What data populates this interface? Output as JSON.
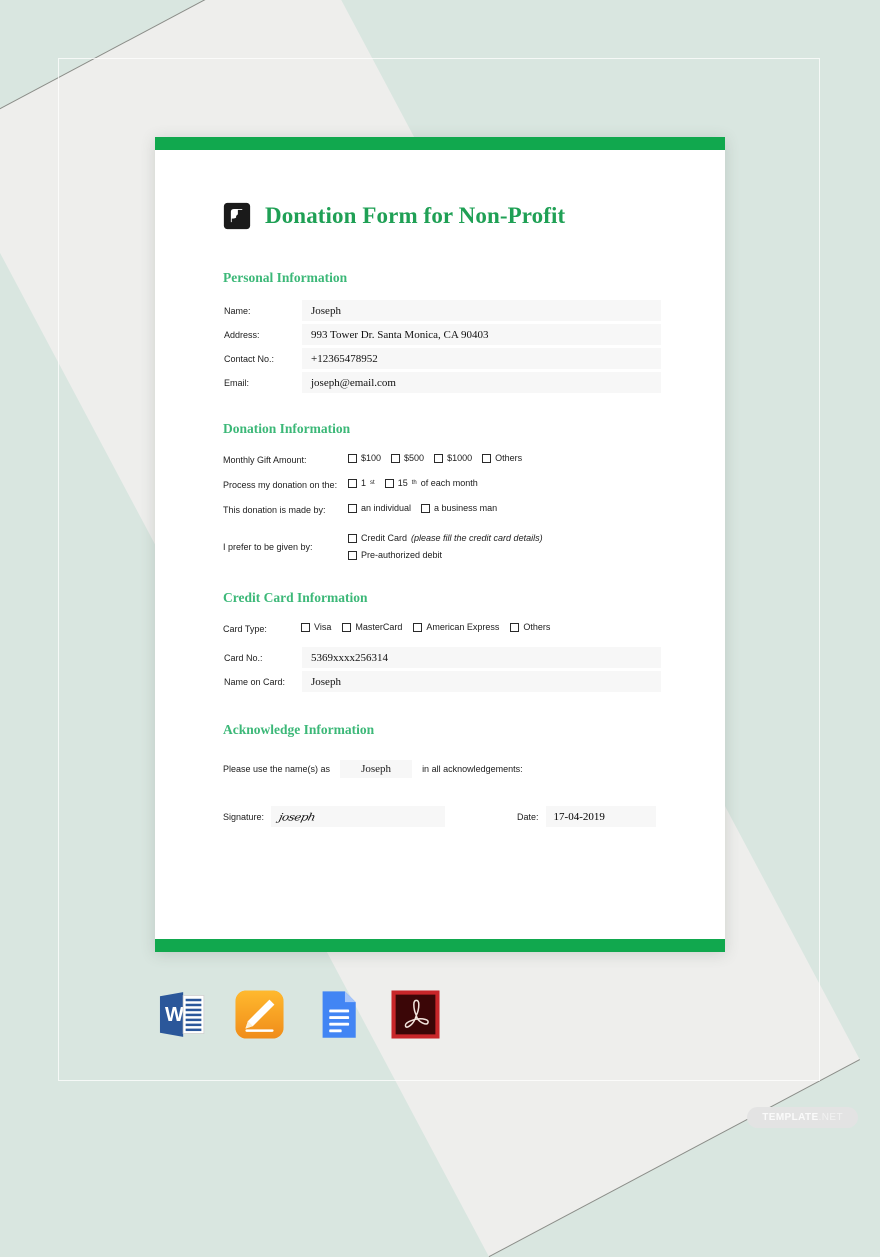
{
  "document": {
    "title": "Donation Form for Non-Profit",
    "logo_icon": "leaf-square-logo-icon",
    "accent_color": "#11a84e",
    "heading_color": "#3cb878",
    "background_color": "#d9e6e0"
  },
  "personal_information": {
    "heading": "Personal Information",
    "fields": [
      {
        "label": "Name:",
        "value": "Joseph"
      },
      {
        "label": "Address:",
        "value": "993 Tower Dr. Santa Monica, CA 90403"
      },
      {
        "label": "Contact No.:",
        "value": "+12365478952"
      },
      {
        "label": "Email:",
        "value": "joseph@email.com"
      }
    ]
  },
  "donation_information": {
    "heading": "Donation Information",
    "gift_amount": {
      "label": "Monthly Gift Amount:",
      "options": [
        "$100",
        "$500",
        "$1000",
        "Others"
      ]
    },
    "process_date": {
      "label": "Process my donation on the:",
      "options": [
        "1",
        "15"
      ],
      "superscripts": [
        "st",
        "th"
      ],
      "tail": "of each month"
    },
    "donor_type": {
      "label": "This donation is made by:",
      "options": [
        "an individual",
        "a business man"
      ]
    },
    "payment_method": {
      "label": "I prefer to be given by:",
      "options": [
        "Credit Card",
        "Pre-authorized debit"
      ],
      "note": "(please fill the credit card details)"
    }
  },
  "credit_card_information": {
    "heading": "Credit Card Information",
    "card_type": {
      "label": "Card Type:",
      "options": [
        "Visa",
        "MasterCard",
        "American Express",
        "Others"
      ]
    },
    "fields": [
      {
        "label": "Card No.:",
        "value": "5369xxxx256314"
      },
      {
        "label": "Name on Card:",
        "value": "Joseph"
      }
    ]
  },
  "acknowledge_information": {
    "heading": "Acknowledge Information",
    "prefix_text": "Please use the name(s) as",
    "name_value": "Joseph",
    "suffix_text": "in all acknowledgements:",
    "signature_label": "Signature:",
    "signature_value": "joseph",
    "date_label": "Date:",
    "date_value": "17-04-2019"
  },
  "format_icons": [
    {
      "name": "microsoft-word-icon",
      "label": "Word"
    },
    {
      "name": "apple-pages-icon",
      "label": "Pages"
    },
    {
      "name": "google-docs-icon",
      "label": "Google Docs"
    },
    {
      "name": "adobe-pdf-icon",
      "label": "PDF"
    }
  ],
  "watermark": {
    "bold_text": "TEMPLATE",
    "light_text": ".NET"
  }
}
